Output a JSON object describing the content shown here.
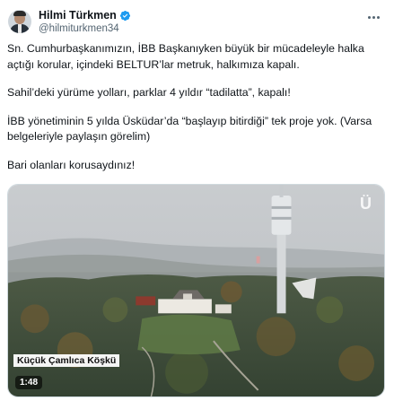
{
  "author": {
    "display_name": "Hilmi Türkmen",
    "handle": "@hilmiturkmen34",
    "verified_icon": "verified-badge-icon"
  },
  "menu_icon": "more-options-icon",
  "tweet": {
    "paragraphs": [
      "Sn. Cumhurbaşkanımızın, İBB Başkanıyken büyük bir mücadeleyle halka açtığı korular, içindeki BELTUR’lar metruk, halkımıza kapalı.",
      "Sahil’deki yürüme yolları, parklar 4 yıldır “tadilatta”, kapalı!",
      "İBB yönetiminin 5 yılda Üsküdar’da “başlayıp bitirdiği” tek proje yok. (Varsa belgeleriyle paylaşın görelim)",
      "Bari olanları korusaydınız!"
    ]
  },
  "media": {
    "caption_overlay": "Küçük Çamlıca Köşkü",
    "duration": "1:48",
    "watermark": "Ü"
  },
  "colors": {
    "accent_blue": "#1d9bf0",
    "secondary_text": "#536471"
  }
}
